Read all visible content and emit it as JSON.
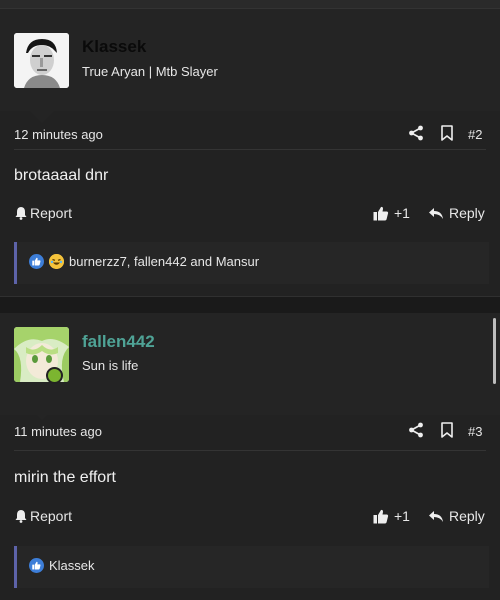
{
  "posts": [
    {
      "username": "Klassek",
      "user_title": "True Aryan | Mtb Slayer",
      "timestamp": "12 minutes ago",
      "post_number": "#2",
      "content": "brotaaaal dnr",
      "report_label": "Report",
      "like_label": "+1",
      "reply_label": "Reply",
      "reactions_text": "burnerzz7, fallen442 and Mansur"
    },
    {
      "username": "fallen442",
      "user_title": "Sun is life",
      "timestamp": "11 minutes ago",
      "post_number": "#3",
      "content": "mirin the effort",
      "report_label": "Report",
      "like_label": "+1",
      "reply_label": "Reply",
      "reactions_text": "Klassek"
    }
  ],
  "colors": {
    "username_default": "#0a0a0a",
    "username_teal": "#4fa396",
    "online_status": "#7cb530",
    "reaction_accent": "#5d63a9",
    "like_blue": "#3d7ed8"
  },
  "icons": [
    "share-icon",
    "bookmark-icon",
    "bell-icon",
    "thumbs-up-icon",
    "reply-arrow-icon",
    "like-reaction-icon",
    "laugh-reaction-icon"
  ]
}
